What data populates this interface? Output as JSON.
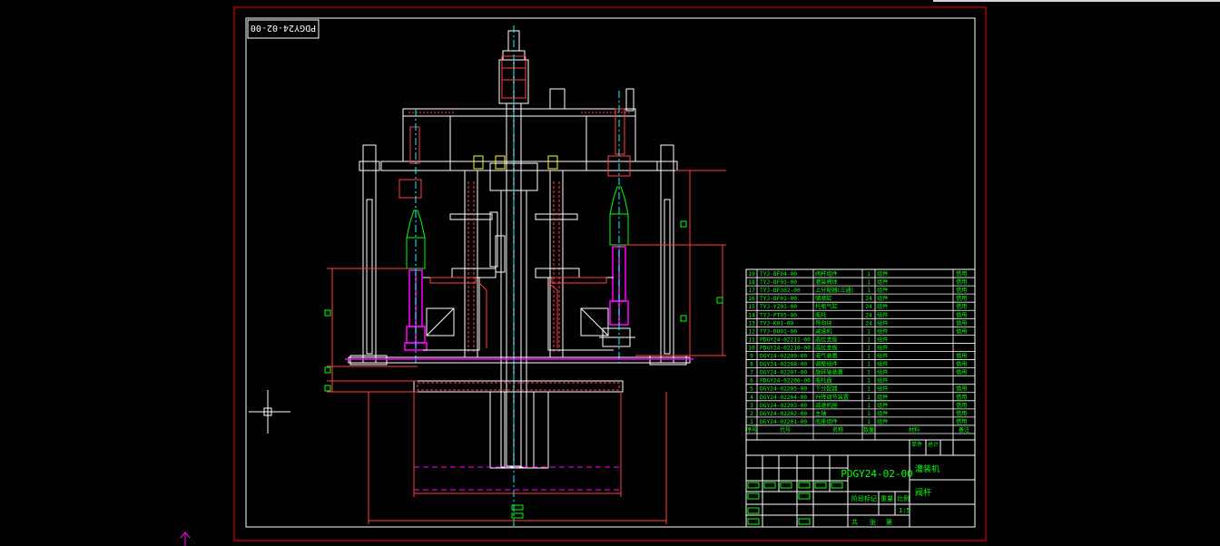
{
  "drawing": {
    "number": "PDGY24-02-00",
    "number_rotated": "PDGY24-02-00",
    "name_line1": "灌装机",
    "name_line2": "阀杆",
    "scale_value": "1:5"
  },
  "bom": {
    "items": [
      {
        "no": "19",
        "code": "TYJ-BF04-00",
        "name": "阀杆组件",
        "qty": "1",
        "mat": "组件",
        "note": "借用"
      },
      {
        "no": "18",
        "code": "TYJ-BF03-00",
        "name": "灌装阀体",
        "qty": "1",
        "mat": "组件",
        "note": "借用"
      },
      {
        "no": "17",
        "code": "TYJ-BF302-00",
        "name": "上分配器(三通)",
        "qty": "1",
        "mat": "组件",
        "note": "借用"
      },
      {
        "no": "16",
        "code": "TYJ-BF01-00",
        "name": "储液缸",
        "qty": "24",
        "mat": "组件",
        "note": "借用"
      },
      {
        "no": "15",
        "code": "TYJ-YZ01-00",
        "name": "托瓶气缸",
        "qty": "24",
        "mat": "组件",
        "note": "借用"
      },
      {
        "no": "14",
        "code": "TYJ-PT05-00",
        "name": "瓶托",
        "qty": "24",
        "mat": "组件",
        "note": "借用"
      },
      {
        "no": "13",
        "code": "TYJ-K01-00",
        "name": "导向块",
        "qty": "24",
        "mat": "组件",
        "note": "借用"
      },
      {
        "no": "12",
        "code": "TYJ-DU01-00",
        "name": "减速机",
        "qty": "1",
        "mat": "组件",
        "note": "借用"
      },
      {
        "no": "11",
        "code": "PDGY24-02211-00",
        "name": "高位支座",
        "qty": "1",
        "mat": "组件",
        "note": ""
      },
      {
        "no": "10",
        "code": "PDGY24-02210-00",
        "name": "高位支板",
        "qty": "1",
        "mat": "组件",
        "note": ""
      },
      {
        "no": "9",
        "code": "DGY24-02209-00",
        "name": "液气装置",
        "qty": "1",
        "mat": "组件",
        "note": "借用"
      },
      {
        "no": "8",
        "code": "DGY24-02208-00",
        "name": "调整组件",
        "qty": "1",
        "mat": "组件",
        "note": "借用"
      },
      {
        "no": "7",
        "code": "DGY24-02207-00",
        "name": "旋转轴装置",
        "qty": "1",
        "mat": "组件",
        "note": "借用"
      },
      {
        "no": "6",
        "code": "PDGY24-02206-00",
        "name": "瓶托盘",
        "qty": "1",
        "mat": "组件",
        "note": ""
      },
      {
        "no": "5",
        "code": "DGY24-02205-00",
        "name": "下分配器",
        "qty": "1",
        "mat": "组件",
        "note": "借用"
      },
      {
        "no": "4",
        "code": "DGY24-02204-00",
        "name": "升降调节装置",
        "qty": "1",
        "mat": "组件",
        "note": "借用"
      },
      {
        "no": "3",
        "code": "DGY24-02203-00",
        "name": "减速机座",
        "qty": "1",
        "mat": "组件",
        "note": "借用"
      },
      {
        "no": "2",
        "code": "DGY24-02202-00",
        "name": "主轴",
        "qty": "1",
        "mat": "组件",
        "note": "借用"
      },
      {
        "no": "1",
        "code": "DGY24-02201-00",
        "name": "底座组件",
        "qty": "1",
        "mat": "组件",
        "note": "借用"
      }
    ],
    "header": {
      "no": "序号",
      "code": "代号",
      "name": "名称",
      "qty": "数量",
      "mat": "材料",
      "note": "备注"
    }
  },
  "title_block": {
    "labels": {
      "mark": "阶段标记",
      "weight": "重量",
      "scale": "比例",
      "sheets": "共",
      "sheet_of": "张",
      "sheet_no": "第",
      "unit": "单件",
      "total": "总计"
    }
  },
  "colors": {
    "frame_red": "#ff0000",
    "line_white": "#ffffff",
    "line_green": "#00ff00",
    "line_magenta": "#ff00ff",
    "line_cyan": "#00ffff",
    "line_yellow": "#ffff00"
  }
}
